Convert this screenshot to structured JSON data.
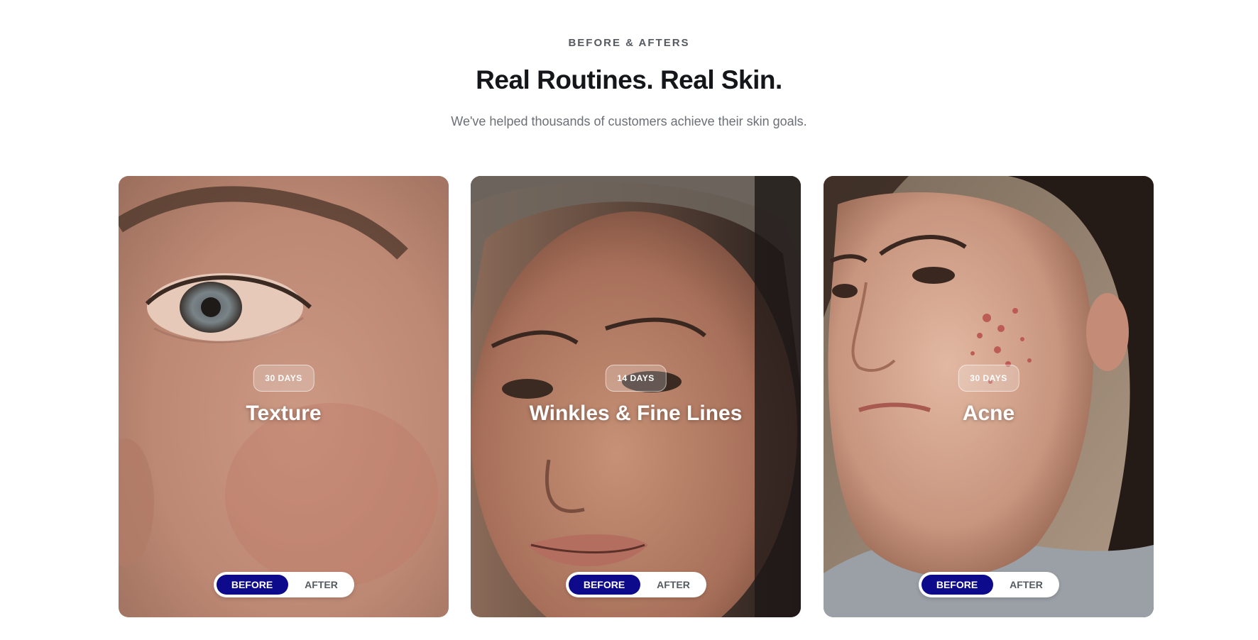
{
  "header": {
    "eyebrow": "BEFORE & AFTERS",
    "title": "Real Routines. Real Skin.",
    "subtitle": "We've helped thousands of customers achieve their skin goals."
  },
  "cards": [
    {
      "badge": "30 DAYS",
      "title": "Texture",
      "before_label": "BEFORE",
      "after_label": "AFTER",
      "image": "close-up-skin-texture-photo"
    },
    {
      "badge": "14 DAYS",
      "title": "Winkles & Fine Lines",
      "before_label": "BEFORE",
      "after_label": "AFTER",
      "image": "smiling-woman-fine-lines-photo"
    },
    {
      "badge": "30 DAYS",
      "title": "Acne",
      "before_label": "BEFORE",
      "after_label": "AFTER",
      "image": "woman-acne-cheek-photo"
    }
  ],
  "colors": {
    "toggle_active": "#0d0a8c",
    "heading": "#14161a",
    "muted_text": "#6b6f76"
  }
}
